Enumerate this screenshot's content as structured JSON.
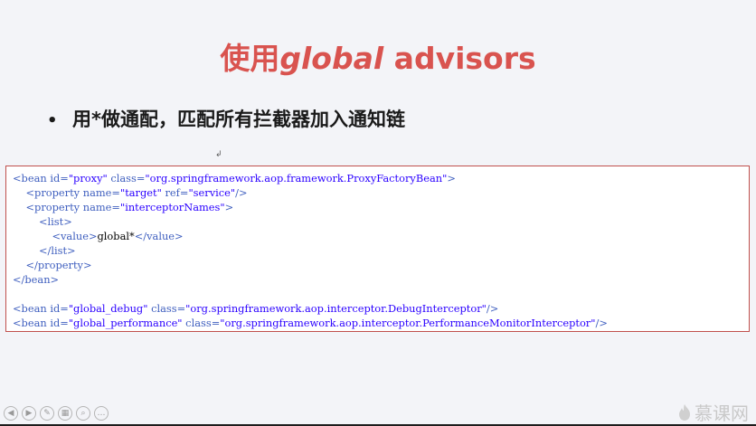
{
  "slide": {
    "title_prefix": "使用",
    "title_italic": "global",
    "title_suffix": " advisors",
    "bullet_marker": "•",
    "bullet_text": "用*做通配，匹配所有拦截器加入通知链",
    "stray_mark": "↲"
  },
  "code": {
    "lines": [
      [
        {
          "t": "tag",
          "v": "<bean id="
        },
        {
          "t": "val",
          "v": "\"proxy\""
        },
        {
          "t": "tag",
          "v": " class="
        },
        {
          "t": "val",
          "v": "\"org.springframework.aop.framework.ProxyFactoryBean\""
        },
        {
          "t": "tag",
          "v": ">"
        }
      ],
      [
        {
          "t": "txt",
          "v": "    "
        },
        {
          "t": "tag",
          "v": "<property name="
        },
        {
          "t": "val",
          "v": "\"target\""
        },
        {
          "t": "tag",
          "v": " ref="
        },
        {
          "t": "val",
          "v": "\"service\""
        },
        {
          "t": "tag",
          "v": "/>"
        }
      ],
      [
        {
          "t": "txt",
          "v": "    "
        },
        {
          "t": "tag",
          "v": "<property name="
        },
        {
          "t": "val",
          "v": "\"interceptorNames\""
        },
        {
          "t": "tag",
          "v": ">"
        }
      ],
      [
        {
          "t": "txt",
          "v": "        "
        },
        {
          "t": "tag",
          "v": "<list>"
        }
      ],
      [
        {
          "t": "txt",
          "v": "            "
        },
        {
          "t": "tag",
          "v": "<value>"
        },
        {
          "t": "txt",
          "v": "global*"
        },
        {
          "t": "tag",
          "v": "</value>"
        }
      ],
      [
        {
          "t": "txt",
          "v": "        "
        },
        {
          "t": "tag",
          "v": "</list>"
        }
      ],
      [
        {
          "t": "txt",
          "v": "    "
        },
        {
          "t": "tag",
          "v": "</property>"
        }
      ],
      [
        {
          "t": "tag",
          "v": "</bean>"
        }
      ],
      [
        {
          "t": "txt",
          "v": " "
        }
      ],
      [
        {
          "t": "tag",
          "v": "<bean id="
        },
        {
          "t": "val",
          "v": "\"global_debug\""
        },
        {
          "t": "tag",
          "v": " class="
        },
        {
          "t": "val",
          "v": "\"org.springframework.aop.interceptor.DebugInterceptor\""
        },
        {
          "t": "tag",
          "v": "/>"
        }
      ],
      [
        {
          "t": "tag",
          "v": "<bean id="
        },
        {
          "t": "val",
          "v": "\"global_performance\""
        },
        {
          "t": "tag",
          "v": " class="
        },
        {
          "t": "val",
          "v": "\"org.springframework.aop.interceptor.PerformanceMonitorInterceptor\""
        },
        {
          "t": "tag",
          "v": "/>"
        }
      ]
    ]
  },
  "controls": [
    {
      "name": "prev-slide-button",
      "glyph": "◀"
    },
    {
      "name": "next-slide-button",
      "glyph": "▶"
    },
    {
      "name": "pen-tool-button",
      "glyph": "✎"
    },
    {
      "name": "slide-grid-button",
      "glyph": "▦"
    },
    {
      "name": "zoom-button",
      "glyph": "⌕"
    },
    {
      "name": "more-options-button",
      "glyph": "…"
    }
  ],
  "watermark": {
    "text": "慕课网",
    "icon": "flame-icon"
  },
  "colors": {
    "title": "#d9534f",
    "code_border": "#c0504d",
    "code_tag": "#3f5fbf",
    "code_value": "#2a00ff"
  }
}
